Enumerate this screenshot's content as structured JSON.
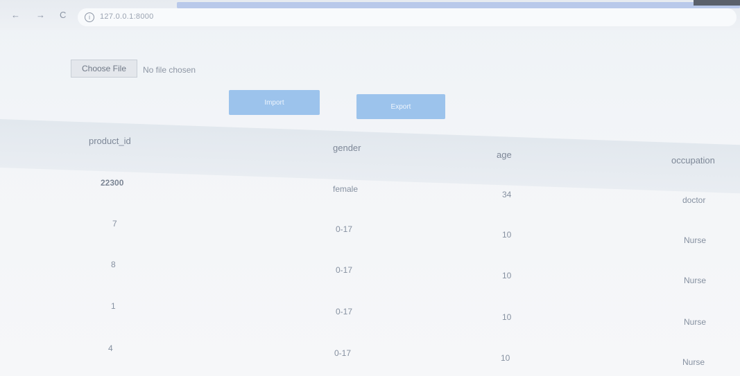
{
  "browser": {
    "back": "←",
    "forward": "→",
    "reload": "C",
    "url": "127.0.0.1:8000"
  },
  "file_input": {
    "button": "Choose File",
    "status": "No file chosen"
  },
  "actions": {
    "import_label": "Import",
    "export_label": "Export"
  },
  "table": {
    "headers": [
      "product_id",
      "gender",
      "age",
      "occupation"
    ],
    "rows": [
      [
        "22300",
        "female",
        "34",
        "doctor"
      ],
      [
        "7",
        "0-17",
        "10",
        "Nurse"
      ],
      [
        "8",
        "0-17",
        "10",
        "Nurse"
      ],
      [
        "1",
        "0-17",
        "10",
        "Nurse"
      ],
      [
        "4",
        "0-17",
        "10",
        "Nurse"
      ]
    ]
  }
}
